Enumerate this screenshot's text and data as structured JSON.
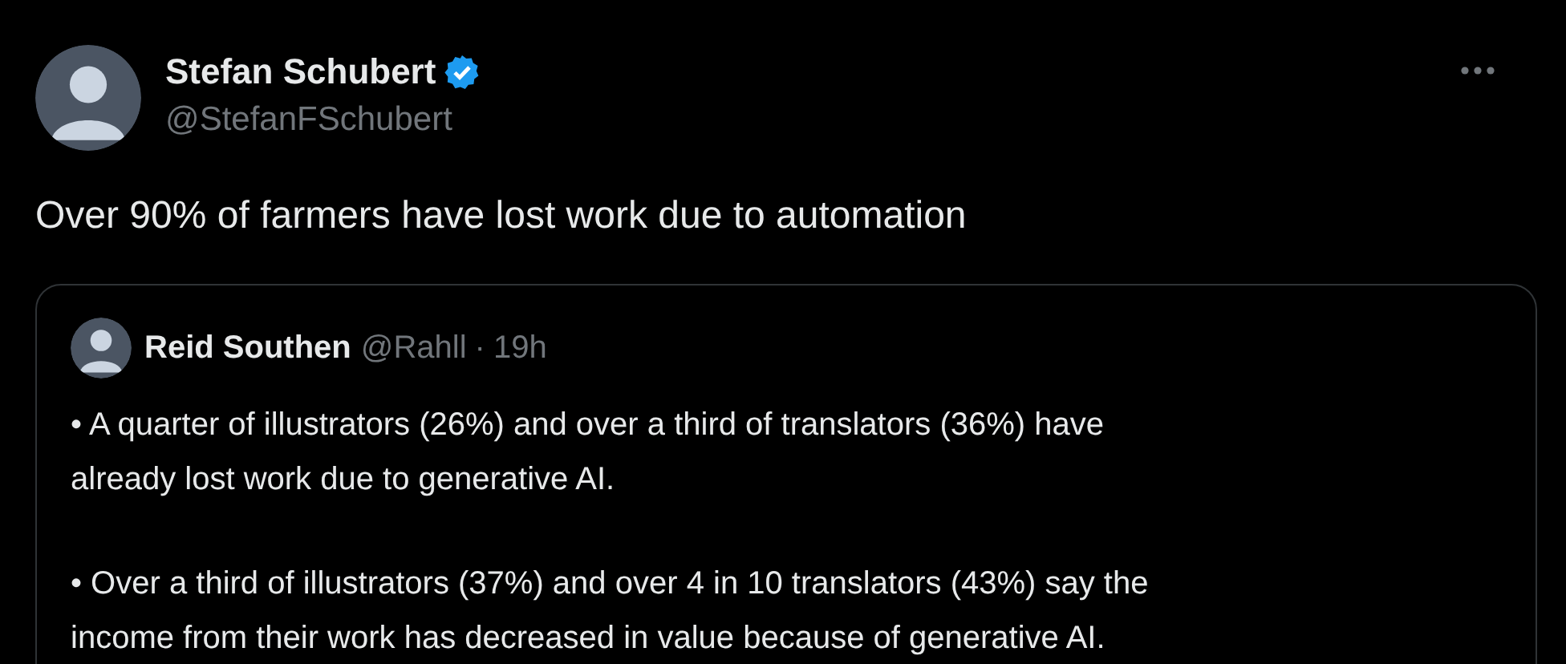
{
  "tweet": {
    "author": {
      "name": "Stefan Schubert",
      "verified": true,
      "handle": "@StefanFSchubert"
    },
    "text": "Over 90% of farmers have lost work due to automation",
    "quote": {
      "author": {
        "name": "Reid Southen",
        "handle": "@Rahll"
      },
      "separator": "·",
      "time": "19h",
      "paragraphs": [
        {
          "lines": [
            "• A quarter of illustrators (26%) and over a third of translators (36%) have",
            "already lost work due to generative AI."
          ]
        },
        {
          "lines": [
            "• Over a third of illustrators (37%) and over 4 in 10 translators (43%) say the",
            "income from their work has decreased in value because of generative AI."
          ]
        }
      ]
    }
  }
}
